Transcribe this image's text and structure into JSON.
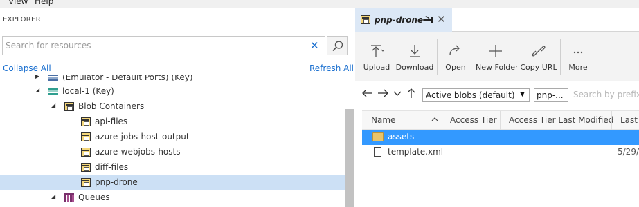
{
  "menu": {
    "items": [
      "View",
      "Help"
    ]
  },
  "explorer": {
    "title": "EXPLORER",
    "search_placeholder": "Search for resources",
    "collapse_all": "Collapse All",
    "refresh_all": "Refresh All",
    "tree": [
      {
        "label": "(Emulator - Default Ports) (Key)",
        "arrow": "▶",
        "icon": "storage-account-icon",
        "depth": 1
      },
      {
        "label": "local-1 (Key)",
        "arrow": "◢",
        "icon": "storage-account-icon",
        "depth": 1
      },
      {
        "label": "Blob Containers",
        "arrow": "◢",
        "icon": "blob-containers-icon",
        "depth": 2
      },
      {
        "label": "api-files",
        "icon": "container-icon",
        "depth": 3
      },
      {
        "label": "azure-jobs-host-output",
        "icon": "container-icon",
        "depth": 3
      },
      {
        "label": "azure-webjobs-hosts",
        "icon": "container-icon",
        "depth": 3
      },
      {
        "label": "diff-files",
        "icon": "container-icon",
        "depth": 3
      },
      {
        "label": "pnp-drone",
        "icon": "container-icon",
        "depth": 3,
        "selected": true
      },
      {
        "label": "Queues",
        "arrow": "◢",
        "icon": "queues-icon",
        "depth": 2
      }
    ]
  },
  "tab": {
    "title": "pnp-drone",
    "pin_icon": "pin-icon",
    "close": "✕"
  },
  "toolbar": {
    "buttons": [
      {
        "label": "Upload",
        "icon": "upload-icon"
      },
      {
        "label": "Download",
        "icon": "download-icon"
      },
      {
        "label": "Open",
        "icon": "open-icon"
      },
      {
        "label": "New Folder",
        "icon": "new-folder-icon"
      },
      {
        "label": "Copy URL",
        "icon": "link-icon"
      },
      {
        "label": "More",
        "icon": "more-icon"
      }
    ]
  },
  "nav": {
    "view_select": "Active blobs (default)",
    "prefix_value": "pnp-...",
    "search_placeholder": "Search by prefix (c"
  },
  "grid": {
    "columns": [
      "Name",
      "Access Tier",
      "Access Tier Last Modified",
      "Last"
    ],
    "rows": [
      {
        "name": "assets",
        "type": "folder",
        "last": "",
        "selected": true
      },
      {
        "name": "template.xml",
        "type": "file",
        "last": "5/29/"
      }
    ]
  },
  "colors": {
    "accent": "#1a6fcf",
    "selection": "#3399ff",
    "tree_selection": "#cce0f5",
    "tab_bg": "#dce8f6"
  }
}
